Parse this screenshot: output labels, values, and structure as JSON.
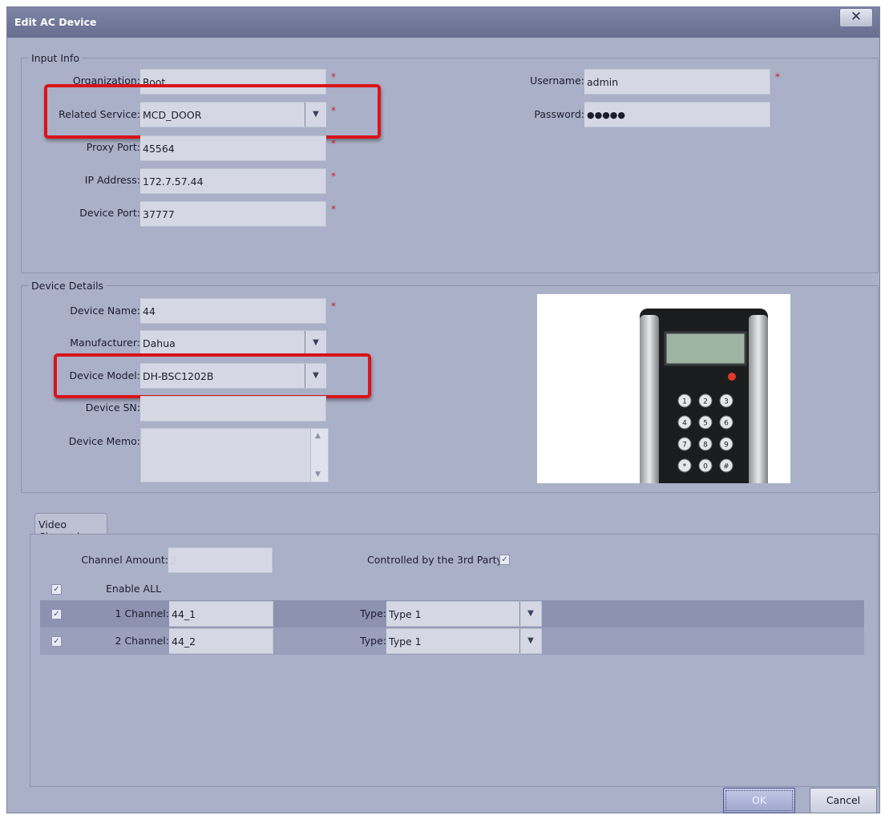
{
  "dialog": {
    "title": "Edit AC Device",
    "close_symbol": "✕"
  },
  "input_info": {
    "legend": "Input Info",
    "organization": {
      "label": "Organization:",
      "value": "Root",
      "required": "*"
    },
    "related_service": {
      "label": "Related Service:",
      "value": "MCD_DOOR",
      "required": "*"
    },
    "proxy_port": {
      "label": "Proxy Port:",
      "value": "45564",
      "required": "*"
    },
    "ip_address": {
      "label": "IP Address:",
      "value": "172.7.57.44",
      "required": "*"
    },
    "device_port": {
      "label": "Device Port:",
      "value": "37777",
      "required": "*"
    },
    "username": {
      "label": "Username:",
      "value": "admin",
      "required": "*"
    },
    "password": {
      "label": "Password:",
      "value": "●●●●●"
    }
  },
  "device_details": {
    "legend": "Device Details",
    "device_name": {
      "label": "Device Name:",
      "value": "44",
      "required": "*"
    },
    "manufacturer": {
      "label": "Manufacturer:",
      "value": "Dahua"
    },
    "device_model": {
      "label": "Device Model:",
      "value": "DH-BSC1202B"
    },
    "device_sn": {
      "label": "Device SN:",
      "value": ""
    },
    "device_memo": {
      "label": "Device Memo:",
      "value": ""
    },
    "keypad_keys": [
      "1",
      "2",
      "3",
      "4",
      "5",
      "6",
      "7",
      "8",
      "9",
      "*",
      "0",
      "#"
    ]
  },
  "video_channel": {
    "tab_label": "Video Channel",
    "channel_amount": {
      "label": "Channel Amount:",
      "value": "2"
    },
    "third_party": {
      "label": "Controlled by the 3rd Party",
      "checked": true
    },
    "enable_all": {
      "label": "Enable ALL",
      "checked": true
    },
    "channels": [
      {
        "label": "1 Channel:",
        "name": "44_1",
        "type_label": "Type:",
        "type": "Type 1",
        "checked": true
      },
      {
        "label": "2 Channel:",
        "name": "44_2",
        "type_label": "Type:",
        "type": "Type 1",
        "checked": true
      }
    ]
  },
  "buttons": {
    "ok": "OK",
    "cancel": "Cancel"
  },
  "icons": {
    "dropdown": "▼",
    "scroll_up": "▲",
    "scroll_down": "▼",
    "check": "✓"
  },
  "colors": {
    "dialog_bg": "#aab0c7",
    "highlight": "#d8141a",
    "required": "#d21c1c"
  }
}
